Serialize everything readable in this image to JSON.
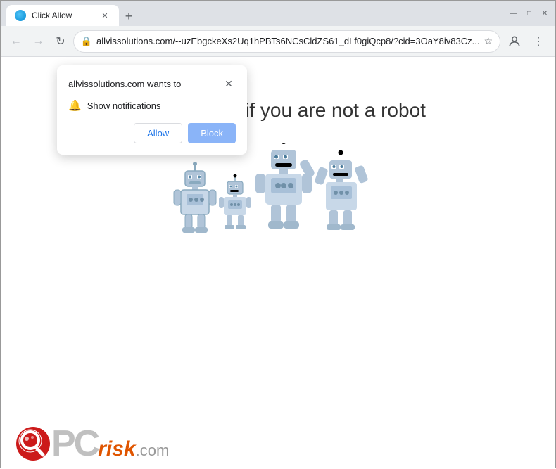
{
  "titlebar": {
    "tab_title": "Click Allow",
    "new_tab_label": "+",
    "minimize": "—",
    "maximize": "□",
    "close": "✕"
  },
  "navbar": {
    "back_tooltip": "Back",
    "forward_tooltip": "Forward",
    "reload_tooltip": "Reload",
    "address": "allvissolutions.com/--uzEbgckeXs2Uq1hPBTs6NCsCldZS61_dLf0giQcp8/?cid=3OaY8iv83Cz...",
    "lock_icon": "🔒"
  },
  "popup": {
    "title": "allvissolutions.com wants to",
    "close_label": "✕",
    "notification_text": "Show notifications",
    "allow_label": "Allow",
    "block_label": "Block"
  },
  "page": {
    "heading": "Click \"Allow\"  if you are not  a robot"
  },
  "brand": {
    "pc_text": "PC",
    "risk_text": "risk",
    "com_text": ".com"
  }
}
